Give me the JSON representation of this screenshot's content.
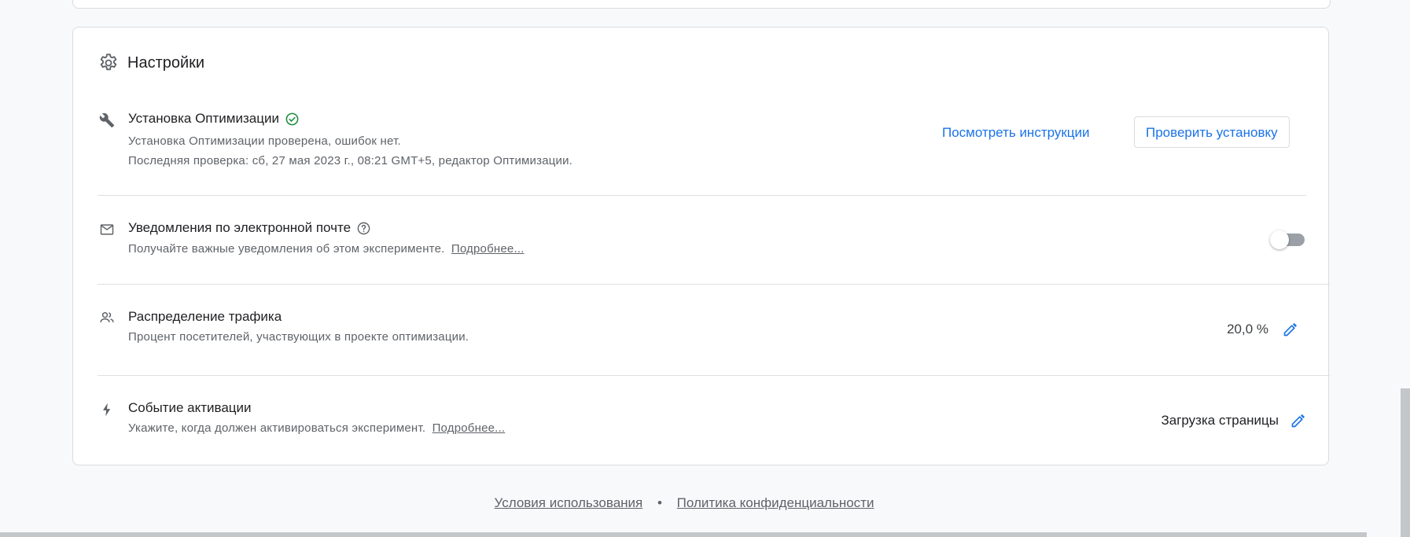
{
  "settings": {
    "title": "Настройки",
    "install": {
      "title": "Установка Оптимизации",
      "desc_line1": "Установка Оптимизации проверена, ошибок нет.",
      "desc_line2": "Последняя проверка: сб, 27 мая 2023 г., 08:21 GMT+5, редактор Оптимизации.",
      "view_instructions_label": "Посмотреть инструкции",
      "check_install_label": "Проверить установку",
      "status": "verified"
    },
    "email": {
      "title": "Уведомления по электронной почте",
      "desc": "Получайте важные уведомления об этом эксперименте.",
      "learn_more": "Подробнее...",
      "toggle_on": false
    },
    "traffic": {
      "title": "Распределение трафика",
      "desc": "Процент посетителей, участвующих в проекте оптимизации.",
      "value": "20,0 %"
    },
    "activation": {
      "title": "Событие активации",
      "desc": "Укажите, когда должен активироваться эксперимент.",
      "learn_more": "Подробнее...",
      "value": "Загрузка страницы"
    }
  },
  "footer": {
    "terms": "Условия использования",
    "separator": "•",
    "privacy": "Политика конфиденциальности"
  },
  "colors": {
    "accent": "#1a73e8",
    "success": "#1e8e3e",
    "text_primary": "#202124",
    "text_secondary": "#5f6368"
  }
}
